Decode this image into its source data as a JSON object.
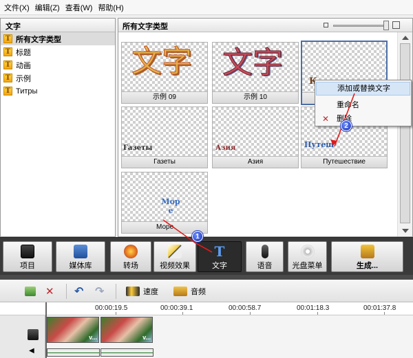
{
  "menu": [
    "文件(X)",
    "编辑(Z)",
    "查看(W)",
    "帮助(H)"
  ],
  "left_panel": {
    "title": "文字",
    "items": [
      {
        "label": "所有文字类型",
        "selected": true
      },
      {
        "label": "标题"
      },
      {
        "label": "动画"
      },
      {
        "label": "示例"
      },
      {
        "label": "Титры"
      }
    ]
  },
  "right_panel": {
    "title": "所有文字类型",
    "thumbnails": [
      {
        "label": "示例 09",
        "preview_text": "文字"
      },
      {
        "label": "示例 10",
        "preview_text": "文字"
      },
      {
        "label": "",
        "preview_text": "К",
        "selected": true
      },
      {
        "label": "Газеты",
        "preview_text": "Газеты"
      },
      {
        "label": "Азия",
        "preview_text": "Азия"
      },
      {
        "label": "Путешествие",
        "preview_text": "Путеш"
      },
      {
        "label": "Море",
        "preview_text": "Мор е"
      }
    ]
  },
  "context_menu": {
    "items": [
      "添加或替换文字",
      "重命名",
      "删除"
    ]
  },
  "callouts": [
    "1",
    "2"
  ],
  "toolbar": {
    "buttons": [
      "项目",
      "媒体库",
      "转场",
      "视频效果",
      "文字",
      "语音",
      "光盘菜单",
      "生成..."
    ],
    "active": "文字"
  },
  "timeline": {
    "speed_label": "速度",
    "audio_label": "音频",
    "ruler": [
      "00:00:19.5",
      "00:00:39.1",
      "00:00:58.7",
      "00:01:18.3",
      "00:01:37.8"
    ],
    "clip_tag": "v..."
  },
  "colors": {
    "toolbar_bg": "#3a3a3a",
    "accent_blue": "#4a6ea8",
    "arrow_red": "#e01b1b"
  }
}
